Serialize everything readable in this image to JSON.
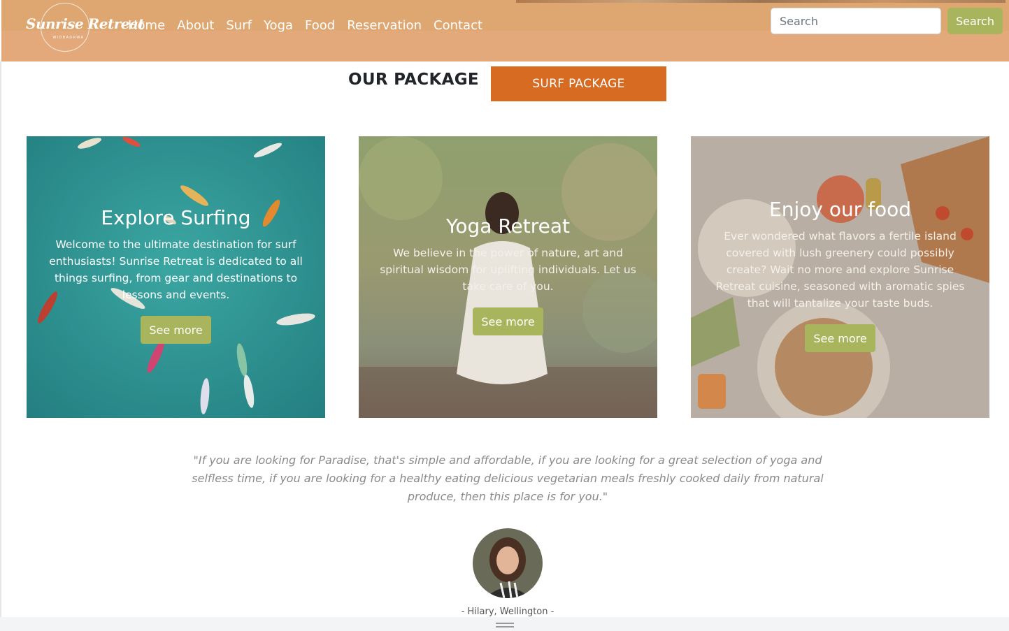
{
  "header": {
    "logo_text": "Sunrise Retreat",
    "logo_subtext": "WIDBADRWA",
    "nav": [
      "Home",
      "About",
      "Surf",
      "Yoga",
      "Food",
      "Reservation",
      "Contact"
    ],
    "search_placeholder": "Search",
    "search_button": "Search"
  },
  "package": {
    "title": "OUR PACKAGE",
    "button": "SURF PACKAGE"
  },
  "cards": [
    {
      "title": "Explore Surfing",
      "text": "Welcome to the ultimate destination for surf enthusiasts! Sunrise Retreat is dedicated to all things surfing, from gear and destinations to lessons and events.",
      "button": "See more"
    },
    {
      "title": "Yoga Retreat",
      "text": "We believe in the power of nature, art and spiritual wisdom for uplifting individuals. Let us take care of you.",
      "button": "See more"
    },
    {
      "title": "Enjoy our food",
      "text": "Ever wondered what flavors a fertile island covered with lush greenery could possibly create? Wait no more and explore Sunrise Retreat cuisine, seasoned with aromatic spies that will tantalize your taste buds.",
      "button": "See more"
    }
  ],
  "testimonial": {
    "quote": "\"If you are looking for Paradise, that's simple and affordable, if you are looking for a great selection of yoga and selfless time, if you are looking for a healthy eating delicious vegetarian meals freshly cooked daily from natural produce, then this place is for you.\"",
    "author": "- Hilary, Wellington -"
  },
  "colors": {
    "header_bg": "#e3a97a",
    "accent_orange": "#d76b22",
    "accent_green": "#a9b55c"
  }
}
